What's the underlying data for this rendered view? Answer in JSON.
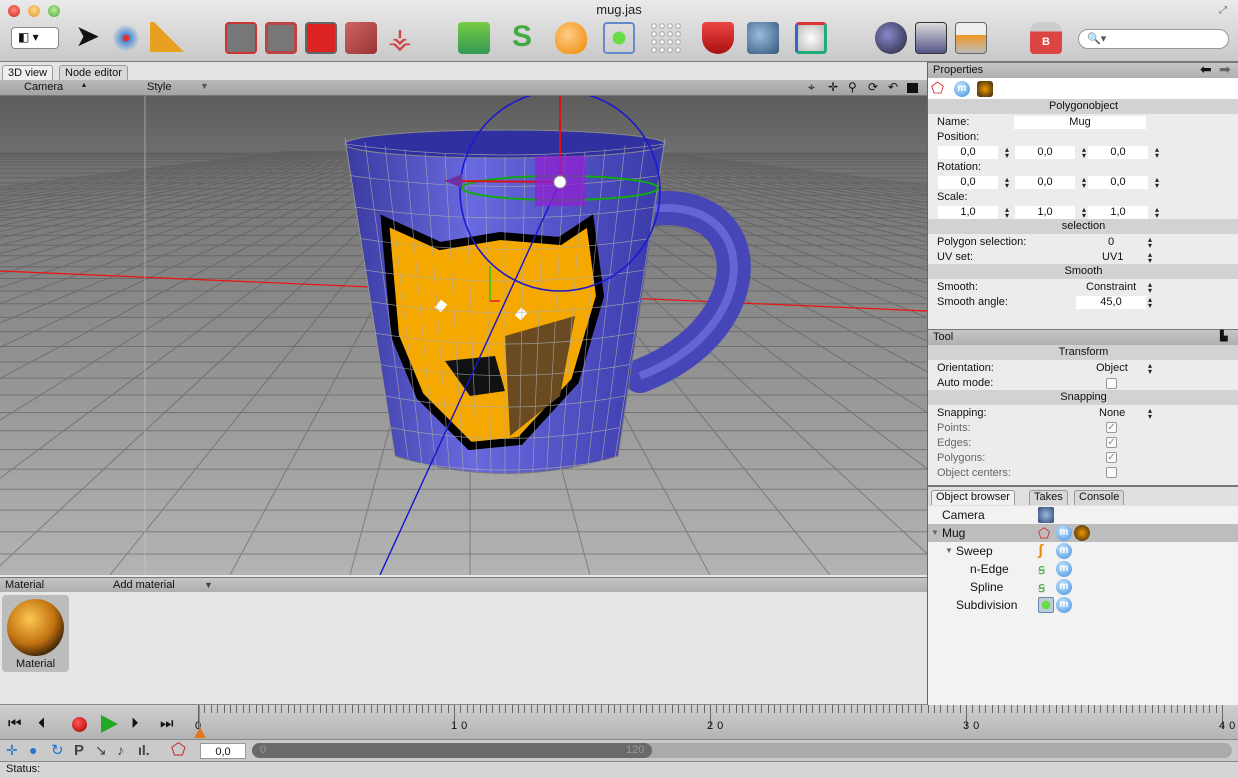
{
  "window": {
    "title": "mug.jas"
  },
  "toolbar": {
    "search_placeholder": "",
    "icons": [
      "layout-icon",
      "pointer-icon",
      "transform-icon",
      "ruler-icon",
      "points-mode-icon",
      "edges-mode-icon",
      "polygons-mode-icon",
      "object-mode-icon",
      "joint-icon",
      "primitives-icon",
      "spline-icon",
      "creator-icon",
      "modifier-icon",
      "particles-icon",
      "deformer-icon",
      "camera-icon",
      "light-icon",
      "render-icon",
      "render-settings-icon",
      "render-movie-icon",
      "weight-icon"
    ]
  },
  "view_tabs": [
    "3D view",
    "Node editor"
  ],
  "viewport_header": {
    "camera": "Camera",
    "style": "Style"
  },
  "material": {
    "header": "Material",
    "add": "Add material",
    "items": [
      {
        "name": "Material"
      }
    ]
  },
  "properties": {
    "title": "Properties",
    "section": "Polygonobject",
    "name_label": "Name:",
    "name": "Mug",
    "position_label": "Position:",
    "position": [
      "0,0",
      "0,0",
      "0,0"
    ],
    "rotation_label": "Rotation:",
    "rotation": [
      "0,0",
      "0,0",
      "0,0"
    ],
    "scale_label": "Scale:",
    "scale": [
      "1,0",
      "1,0",
      "1,0"
    ],
    "selection_section": "selection",
    "polygon_selection_label": "Polygon selection:",
    "polygon_selection": "0",
    "uv_set_label": "UV set:",
    "uv_set": "UV1",
    "smooth_section": "Smooth",
    "smooth_label": "Smooth:",
    "smooth": "Constraint",
    "smooth_angle_label": "Smooth angle:",
    "smooth_angle": "45,0"
  },
  "tool": {
    "title": "Tool",
    "transform_section": "Transform",
    "orientation_label": "Orientation:",
    "orientation": "Object",
    "auto_mode_label": "Auto mode:",
    "auto_mode": false,
    "snapping_section": "Snapping",
    "snapping_label": "Snapping:",
    "snapping": "None",
    "points_label": "Points:",
    "points": true,
    "edges_label": "Edges:",
    "edges": true,
    "polygons_label": "Polygons:",
    "polygons": true,
    "object_centers_label": "Object centers:",
    "object_centers": false
  },
  "browser": {
    "tabs": [
      "Object browser",
      "Takes",
      "Console"
    ],
    "objects": [
      {
        "name": "Camera",
        "level": 0
      },
      {
        "name": "Mug",
        "level": 0,
        "expanded": true,
        "selected": true
      },
      {
        "name": "Sweep",
        "level": 1,
        "expanded": true
      },
      {
        "name": "n-Edge",
        "level": 2
      },
      {
        "name": "Spline",
        "level": 2
      },
      {
        "name": "Subdivision",
        "level": 1
      }
    ]
  },
  "timeline": {
    "labels": [
      "0",
      "10",
      "20",
      "30",
      "40"
    ],
    "current_frame": "0,0",
    "range_start": "0",
    "range_end": "120"
  },
  "status": {
    "label": "Status:"
  }
}
